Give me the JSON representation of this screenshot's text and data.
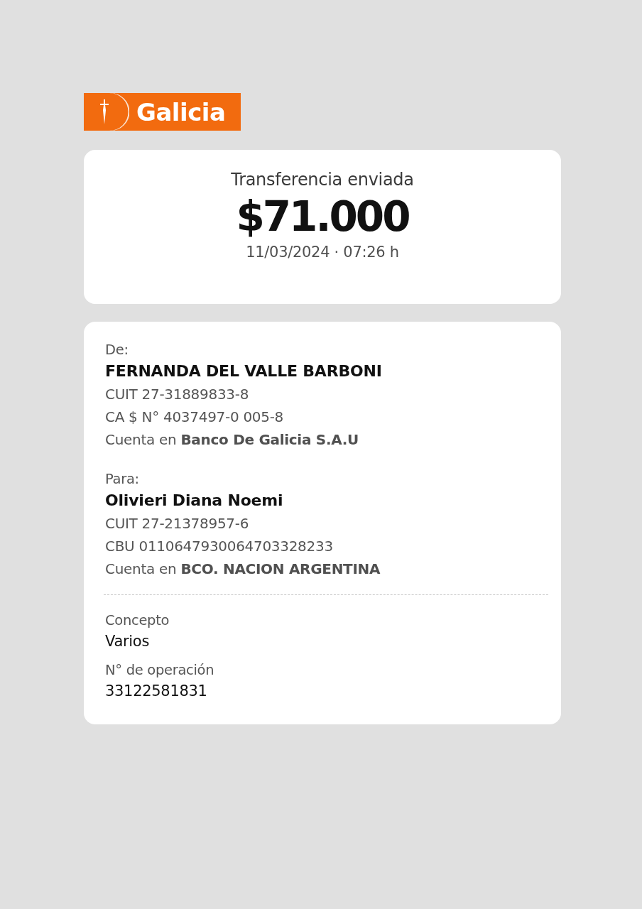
{
  "logo": "Galicia",
  "summary": {
    "title": "Transferencia enviada",
    "amount": "$71.000",
    "datetime": "11/03/2024 · 07:26 h"
  },
  "parties": [
    {
      "label": "De:",
      "name": "FERNANDA DEL VALLE BARBONI",
      "lines": [
        "CUIT 27-31889833-8",
        "CA $ N° 4037497-0 005-8",
        "Cuenta en **Banco De Galicia S.A.U**"
      ]
    },
    {
      "label": "Para:",
      "name": "Olivieri Diana Noemi",
      "lines": [
        "CUIT 27-21378957-6",
        "CBU 0110647930064703328233",
        "Cuenta en **BCO. NACION ARGENTINA**"
      ]
    }
  ],
  "details": [
    {
      "label": "Concepto",
      "value": "Varios"
    },
    {
      "label": "N° de operación",
      "value": "33122581831"
    }
  ]
}
